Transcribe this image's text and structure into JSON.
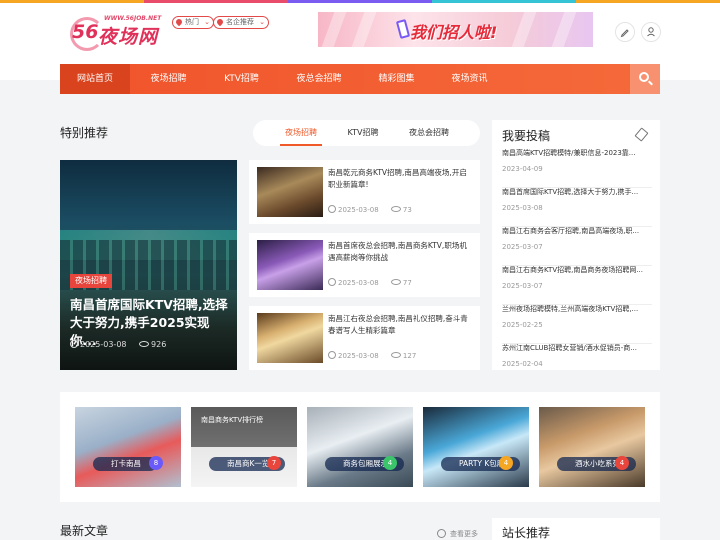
{
  "colors": {
    "primary": "#f0532b",
    "nav_active": "#d9441f",
    "badge": "#e8453c",
    "topstrip": [
      "#f5a623",
      "#e94b6a",
      "#7b5cf0",
      "#34c4d6",
      "#f5a623"
    ]
  },
  "header": {
    "logo": {
      "url": "WWW.56JOB.NET",
      "num": "56",
      "name": "夜场网"
    },
    "selector_hot": "热门",
    "selector_company": "名企推荐",
    "banner_text": "我们招人啦!",
    "icons": [
      "pencil-icon",
      "user-icon"
    ]
  },
  "nav": {
    "items": [
      "网站首页",
      "夜场招聘",
      "KTV招聘",
      "夜总会招聘",
      "精彩图集",
      "夜场资讯"
    ],
    "active_index": 0
  },
  "featured": {
    "title": "特别推荐",
    "tabs": [
      "夜场招聘",
      "KTV招聘",
      "夜总会招聘"
    ],
    "active_tab": 0,
    "main": {
      "badge": "夜场招聘",
      "title": "南昌首席国际KTV招聘,选择大于努力,携手2025实现你...",
      "date": "2025-03-08",
      "views": "926"
    },
    "cards": [
      {
        "title": "南昌乾元商务KTV招聘,南昌高端夜场,开启职业新篇章!",
        "date": "2025-03-08",
        "views": "73"
      },
      {
        "title": "南昌首席夜总会招聘,南昌商务KTV,职场机遇高薪岗等你挑战",
        "date": "2025-03-08",
        "views": "77"
      },
      {
        "title": "南昌江右夜总会招聘,南昌礼仪招聘,奋斗青春谱写人生精彩篇章",
        "date": "2025-03-08",
        "views": "127"
      }
    ]
  },
  "submit": {
    "title": "我要投稿",
    "items": [
      {
        "title": "南昌高端KTV招聘模特/兼职信息-2023靠...",
        "date": "2023-04-09"
      },
      {
        "title": "南昌首席国际KTV招聘,选择大于努力,携手...",
        "date": "2025-03-08"
      },
      {
        "title": "南昌江右商务会客厅招聘,南昌高端夜场,职...",
        "date": "2025-03-07"
      },
      {
        "title": "南昌江右商务KTV招聘,南昌商务夜场招聘网...",
        "date": "2025-03-07"
      },
      {
        "title": "兰州夜场招聘模特,兰州高端夜场KTV招聘,...",
        "date": "2025-02-25"
      },
      {
        "title": "苏州江南CLUB招聘女营销/酒水促销员-商...",
        "date": "2025-02-04"
      }
    ]
  },
  "gallery": {
    "items": [
      {
        "label": "打卡南昌",
        "count": "8",
        "count_color": "#6a5af9"
      },
      {
        "label": "南昌商K一览",
        "count": "7",
        "count_color": "#e8453c"
      },
      {
        "label": "商务包厢展示",
        "count": "4",
        "count_color": "#3cc46b"
      },
      {
        "label": "PARTY K包厢",
        "count": "4",
        "count_color": "#f5a623"
      },
      {
        "label": "酒水小吃系列",
        "count": "4",
        "count_color": "#e8453c"
      }
    ],
    "poster_title": "南昌商务KTV排行榜"
  },
  "latest": {
    "title": "最新文章",
    "more": "查看更多"
  },
  "recommend": {
    "title": "站长推荐"
  }
}
